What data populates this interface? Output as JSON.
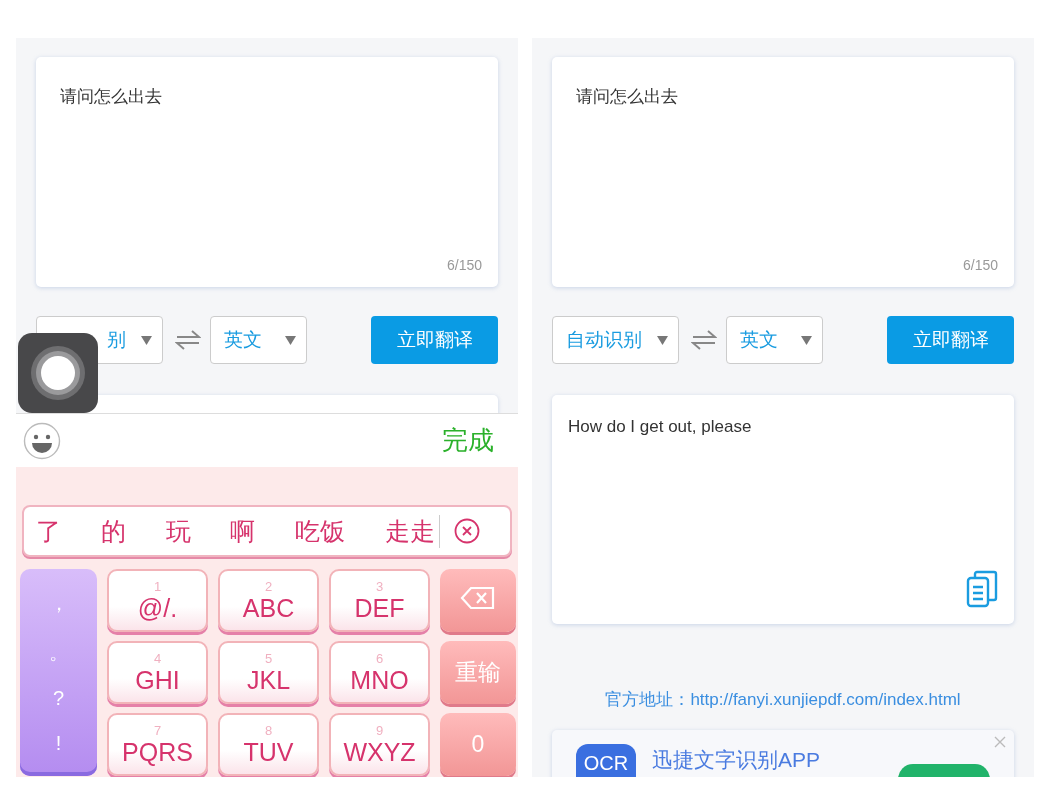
{
  "panels": [
    {
      "input": {
        "text": "请问怎么出去",
        "counter": "6/150"
      },
      "source_language": "别",
      "target_language": "英文",
      "translate_button": "立即翻译"
    },
    {
      "input": {
        "text": "请问怎么出去",
        "counter": "6/150"
      },
      "source_language": "自动识别",
      "target_language": "英文",
      "translate_button": "立即翻译",
      "output": {
        "text": "How do I get out, please"
      },
      "official_site": {
        "label": "官方地址：",
        "url": "http://fanyi.xunjiepdf.com/index.html"
      },
      "ad": {
        "icon_text": "OCR",
        "title": "迅捷文字识别APP"
      }
    }
  ],
  "keyboard": {
    "done": "完成",
    "candidates": [
      "了",
      "的",
      "玩",
      "啊",
      "吃饭",
      "走走"
    ],
    "punctuation": [
      "，",
      "。",
      "?",
      "!"
    ],
    "keys": [
      {
        "digit": "1",
        "letters": "@/."
      },
      {
        "digit": "2",
        "letters": "ABC"
      },
      {
        "digit": "3",
        "letters": "DEF"
      },
      {
        "digit": "4",
        "letters": "GHI"
      },
      {
        "digit": "5",
        "letters": "JKL"
      },
      {
        "digit": "6",
        "letters": "MNO"
      },
      {
        "digit": "7",
        "letters": "PQRS"
      },
      {
        "digit": "8",
        "letters": "TUV"
      },
      {
        "digit": "9",
        "letters": "WXYZ"
      }
    ],
    "side_keys": [
      {
        "kind": "backspace"
      },
      {
        "kind": "text",
        "label": "重输"
      },
      {
        "kind": "text",
        "label": "0"
      }
    ]
  }
}
